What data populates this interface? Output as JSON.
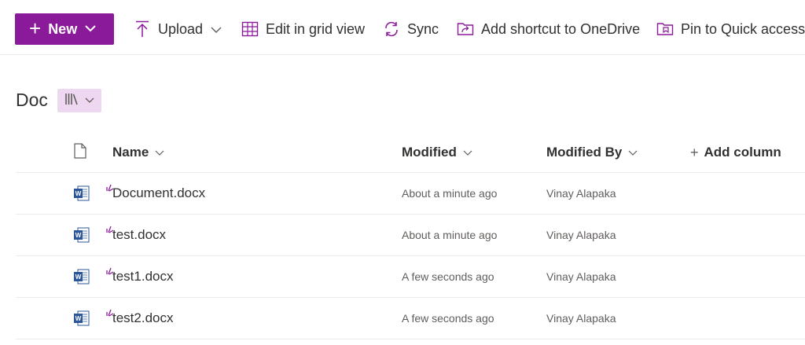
{
  "toolbar": {
    "new_label": "New",
    "upload_label": "Upload",
    "grid_label": "Edit in grid view",
    "sync_label": "Sync",
    "shortcut_label": "Add shortcut to OneDrive",
    "pin_label": "Pin to Quick access"
  },
  "library": {
    "title": "Doc"
  },
  "columns": {
    "name": "Name",
    "modified": "Modified",
    "modified_by": "Modified By",
    "add_column": "Add column"
  },
  "rows": [
    {
      "name": "Document.docx",
      "modified": "About a minute ago",
      "modified_by": "Vinay Alapaka"
    },
    {
      "name": "test.docx",
      "modified": "About a minute ago",
      "modified_by": "Vinay Alapaka"
    },
    {
      "name": "test1.docx",
      "modified": "A few seconds ago",
      "modified_by": "Vinay Alapaka"
    },
    {
      "name": "test2.docx",
      "modified": "A few seconds ago",
      "modified_by": "Vinay Alapaka"
    }
  ],
  "colors": {
    "accent": "#8b1a9a",
    "view_button_bg": "#eed7f1",
    "word_blue": "#2b579a"
  }
}
